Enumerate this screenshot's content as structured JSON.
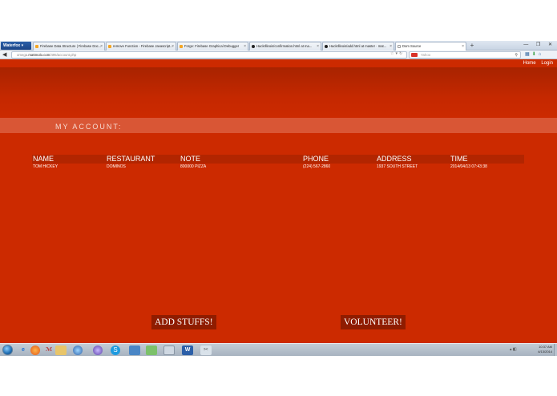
{
  "browser": {
    "app_button": "Waterfox",
    "tabs": [
      {
        "label": "Firebase Data Structure | Firebase Doc..."
      },
      {
        "label": "remove Function - Firebase Javascript..."
      },
      {
        "label": "Forge: Firebase Graphical Debugger"
      },
      {
        "label": "HackIllinois/confirmation.html at ma..."
      },
      {
        "label": "HackIllinois/add.html at master · mat..."
      },
      {
        "label": "Dom Source"
      }
    ],
    "new_tab": "+",
    "window_controls": "— ❐ ✕",
    "url_prefix": "omega.",
    "url_domain": "mattmolo.com",
    "url_path": "/495/account.php",
    "search_placeholder": "Yahoo",
    "icons": {
      "back": "back-arrow-icon",
      "reload": "reload-icon",
      "home": "home-icon",
      "download": "download-icon",
      "bookmark": "bookmark-icon"
    }
  },
  "site": {
    "nav": {
      "home": "Home",
      "login": "Login"
    },
    "section_title": "MY ACCOUNT:",
    "table": {
      "headers": [
        "NAME",
        "RESTAURANT",
        "NOTE",
        "PHONE",
        "ADDRESS",
        "TIME"
      ],
      "rows": [
        [
          "TOM HICKEY",
          "DOMINOS",
          "800000 PIZZA",
          "(224) 567-2860",
          "1937 SOUTH STREET",
          "2014/04/13 07:43:38"
        ]
      ]
    },
    "buttons": {
      "add": "ADD STUFFS!",
      "volunteer": "VOLUNTEER!"
    },
    "colors": {
      "background": "#cc2a00",
      "header_band": "#d95635",
      "table_header": "#b22500",
      "button": "#8f1c00"
    }
  },
  "taskbar": {
    "clock_time": "10:37 AM",
    "clock_date": "4/13/2014",
    "apps": [
      "ie-icon",
      "firefox-icon",
      "folder-icon",
      "waterfox-icon",
      "eclipse-icon",
      "skype-icon",
      "disk-icon",
      "paint-icon",
      "explorer-icon",
      "word-icon",
      "snipping-icon"
    ]
  }
}
